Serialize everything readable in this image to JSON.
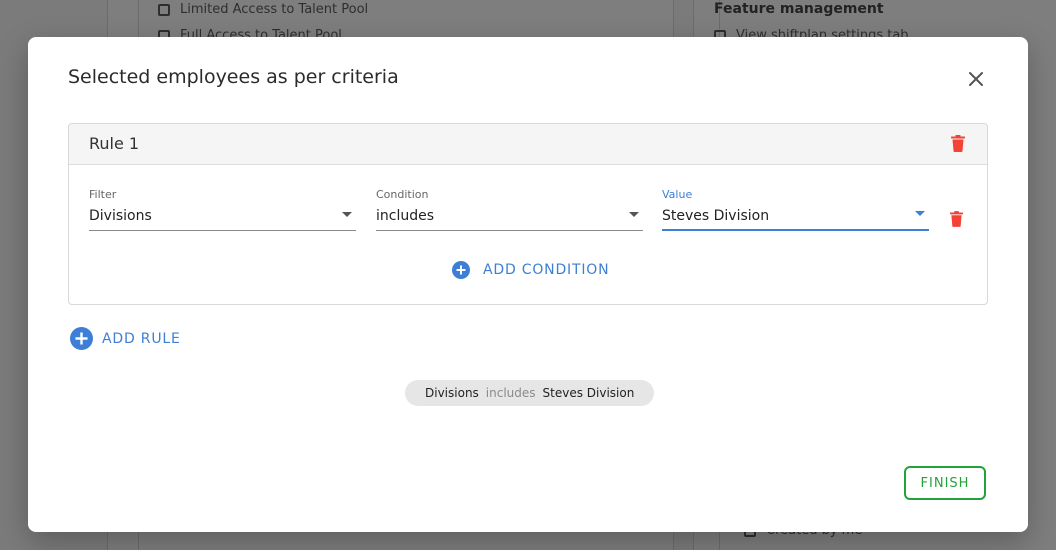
{
  "background": {
    "left_checkboxes": [
      {
        "label": "Limited Access to Talent Pool"
      },
      {
        "label": "Full Access to Talent Pool"
      }
    ],
    "right_heading": "Feature management",
    "right_checkboxes": [
      {
        "label": "View shiftplan settings tab"
      },
      {
        "label": "Created by me"
      }
    ]
  },
  "modal": {
    "title": "Selected employees as per criteria",
    "rule": {
      "title": "Rule 1",
      "filter": {
        "label": "Filter",
        "value": "Divisions"
      },
      "condition": {
        "label": "Condition",
        "value": "includes"
      },
      "value": {
        "label": "Value",
        "value": "Steves Division"
      }
    },
    "add_condition_label": "ADD CONDITION",
    "add_rule_label": "ADD RULE",
    "summary_chip": {
      "field": "Divisions",
      "operator": "includes",
      "value": "Steves Division"
    },
    "finish_label": "FINISH"
  },
  "colors": {
    "accent": "#3d7fd6",
    "danger": "#f44336",
    "success": "#22a33a"
  },
  "icons": {
    "close": "close-icon",
    "delete": "trash-icon",
    "add": "plus-circle-icon",
    "dropdown": "caret-down-icon"
  }
}
